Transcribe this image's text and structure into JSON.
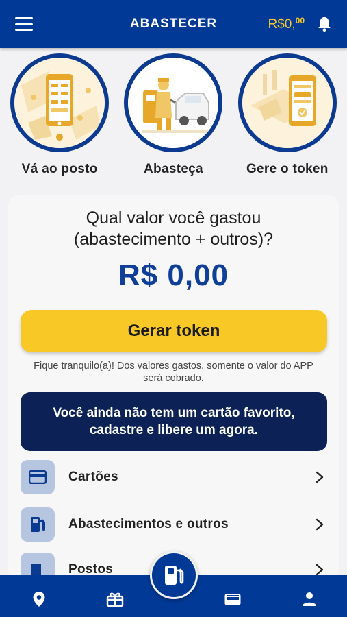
{
  "header": {
    "title": "ABASTECER",
    "balance_main": "R$0,",
    "balance_cents": "00",
    "menu_icon": "hamburger-menu-icon",
    "bell_icon": "bell-icon"
  },
  "steps": [
    {
      "label": "Vá ao posto",
      "icon": "phone-map-illustration"
    },
    {
      "label": "Abasteça",
      "icon": "fuel-attendant-illustration"
    },
    {
      "label": "Gere o token",
      "icon": "phone-token-illustration"
    }
  ],
  "card": {
    "question": "Qual valor você gastou (abastecimento + outros)?",
    "amount": "R$ 0,00",
    "token_button": "Gerar token",
    "note": "Fique tranquilo(a)! Dos valores gastos, somente o valor do APP será cobrado.",
    "favorite_banner": "Você ainda não tem um cartão favorito, cadastre e libere um agora.",
    "menu_items": [
      {
        "label": "Cartões",
        "icon": "credit-card-icon"
      },
      {
        "label": "Abastecimentos e outros",
        "icon": "fuel-pump-icon"
      },
      {
        "label": "Postos",
        "icon": "gas-station-icon"
      }
    ]
  },
  "bottom_nav": {
    "items": [
      "location-pin-icon",
      "gift-icon",
      "fuel-pump-icon",
      "wallet-icon",
      "user-icon"
    ]
  },
  "colors": {
    "primary": "#003a96",
    "accent": "#f8c827",
    "amount": "#0f3f98",
    "banner": "#0c2256",
    "icon_bg": "#b7c6e0"
  }
}
